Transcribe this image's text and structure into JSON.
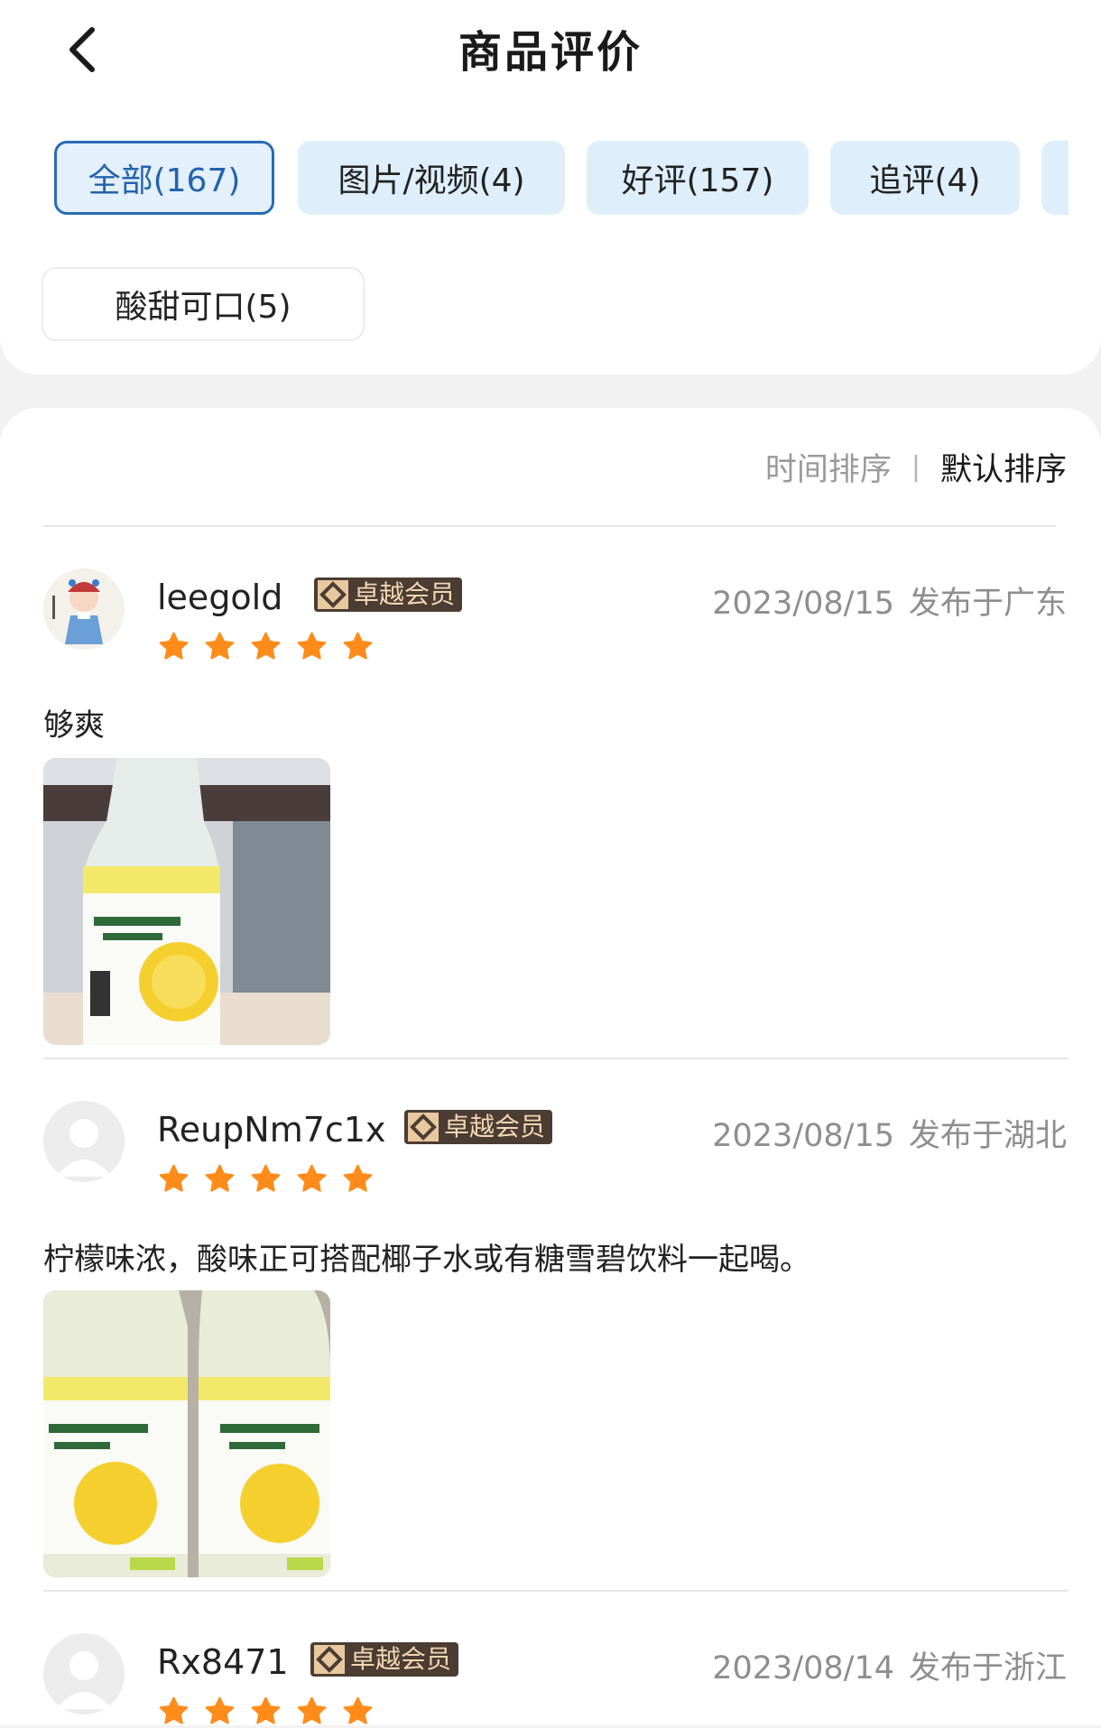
{
  "header": {
    "title": "商品评价",
    "back_icon": "back-arrow-icon"
  },
  "tabs": [
    {
      "label": "全部(167)",
      "active": true
    },
    {
      "label": "图片/视频(4)",
      "active": false
    },
    {
      "label": "好评(157)",
      "active": false
    },
    {
      "label": "追评(4)",
      "active": false
    }
  ],
  "tag_chip": {
    "label": "酸甜可口(5)"
  },
  "sort": {
    "time_label": "时间排序",
    "separator": "|",
    "default_label": "默认排序"
  },
  "reviews": [
    {
      "user": "leegold",
      "badge": "卓越会员",
      "date": "2023/08/15",
      "location": "发布于广东",
      "rating": 5,
      "content": "够爽",
      "photo": "lemon-juice-bottle-photo"
    },
    {
      "user": "ReupNm7c1x",
      "badge": "卓越会员",
      "date": "2023/08/15",
      "location": "发布于湖北",
      "rating": 5,
      "content": "柠檬味浓，酸味正可搭配椰子水或有糖雪碧饮料一起喝。",
      "photo": "two-lemon-juice-bottles-photo"
    },
    {
      "user": "Rx8471",
      "badge": "卓越会员",
      "date": "2023/08/14",
      "location": "发布于浙江",
      "rating": 5
    }
  ],
  "colors": {
    "accent": "#2a6bb5",
    "tab_bg": "#dfeefb",
    "star": "#ff8c1a",
    "badge_bg": "#4b3d33",
    "badge_text": "#f2d7b3"
  }
}
